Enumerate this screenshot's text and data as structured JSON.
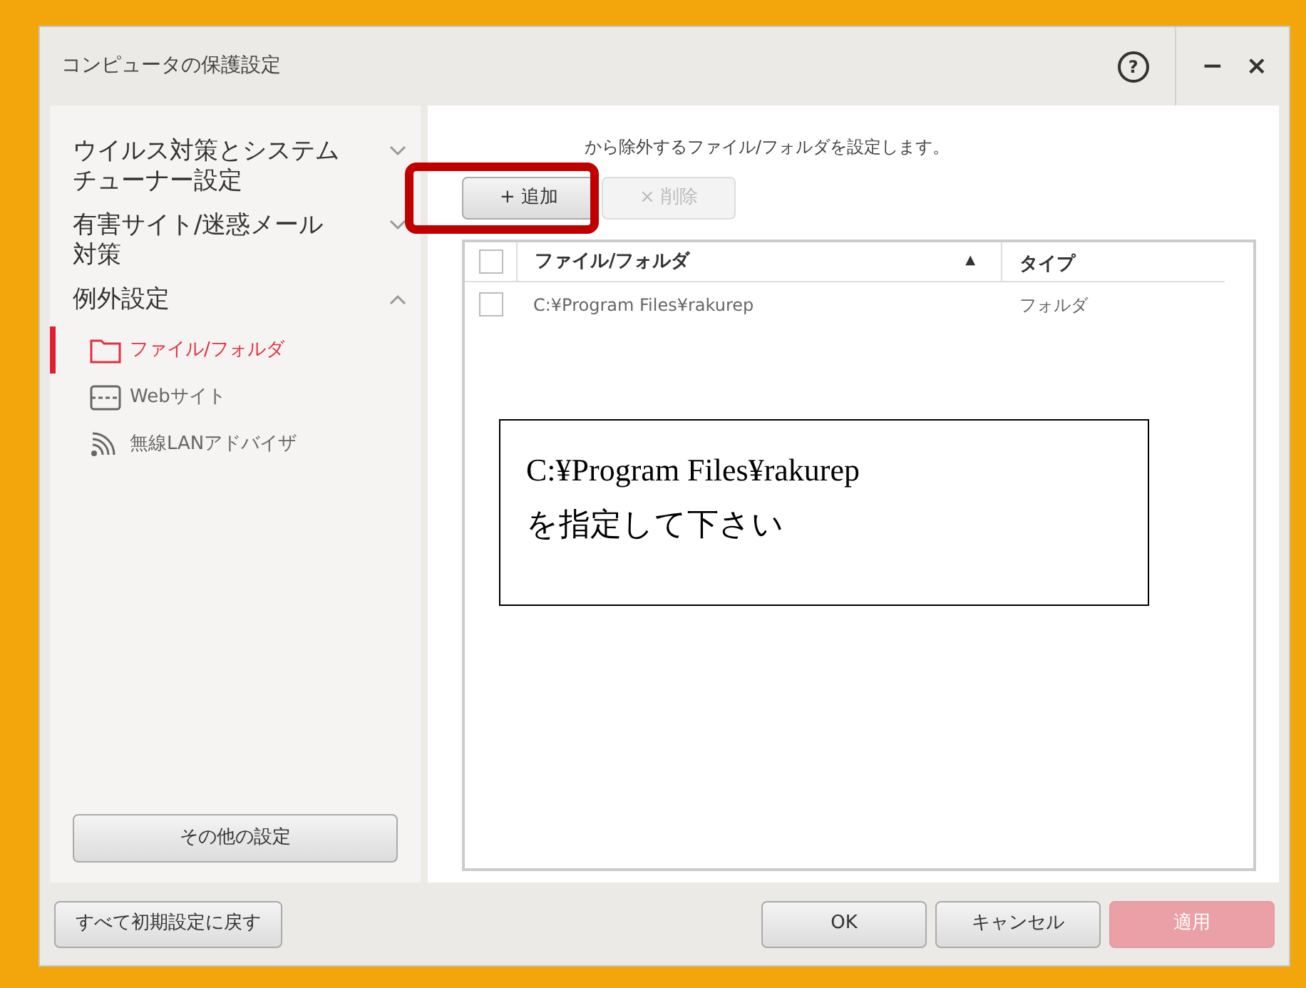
{
  "window": {
    "title": "コンピュータの保護設定",
    "help": "?",
    "minimize": "−",
    "close": "×"
  },
  "sidebar": {
    "groups": [
      {
        "label": "ウイルス対策とシステムチューナー設定",
        "expanded": false
      },
      {
        "label": "有害サイト/迷惑メール対策",
        "expanded": false
      },
      {
        "label": "例外設定",
        "expanded": true,
        "children": [
          {
            "label": "ファイル/フォルダ",
            "selected": true
          },
          {
            "label": "Webサイト",
            "selected": false
          },
          {
            "label": "無線LANアドバイザ",
            "selected": false
          }
        ]
      }
    ],
    "other_button": "その他の設定"
  },
  "content": {
    "description": "から除外するファイル/フォルダを設定します。",
    "buttons": [
      {
        "label": "+ 追加",
        "disabled": false
      },
      {
        "label": "× 削除",
        "disabled": true
      }
    ],
    "table": {
      "all_checked": false,
      "columns": [
        {
          "label": "ファイル/フォルダ",
          "sort": "▲"
        },
        {
          "label": "タイプ"
        }
      ],
      "rows": [
        {
          "checked": false,
          "cells": [
            "C:¥Program Files¥rakurep",
            "フォルダ"
          ]
        }
      ]
    }
  },
  "callout": {
    "lines": [
      "C:¥Program Files¥rakurep",
      "を指定して下さい"
    ]
  },
  "footer": {
    "reset": "すべて初期設定に戻す",
    "buttons": [
      {
        "label": "OK",
        "disabled": false
      },
      {
        "label": "キャンセル",
        "disabled": false
      },
      {
        "label": "適用",
        "disabled": true
      }
    ]
  }
}
